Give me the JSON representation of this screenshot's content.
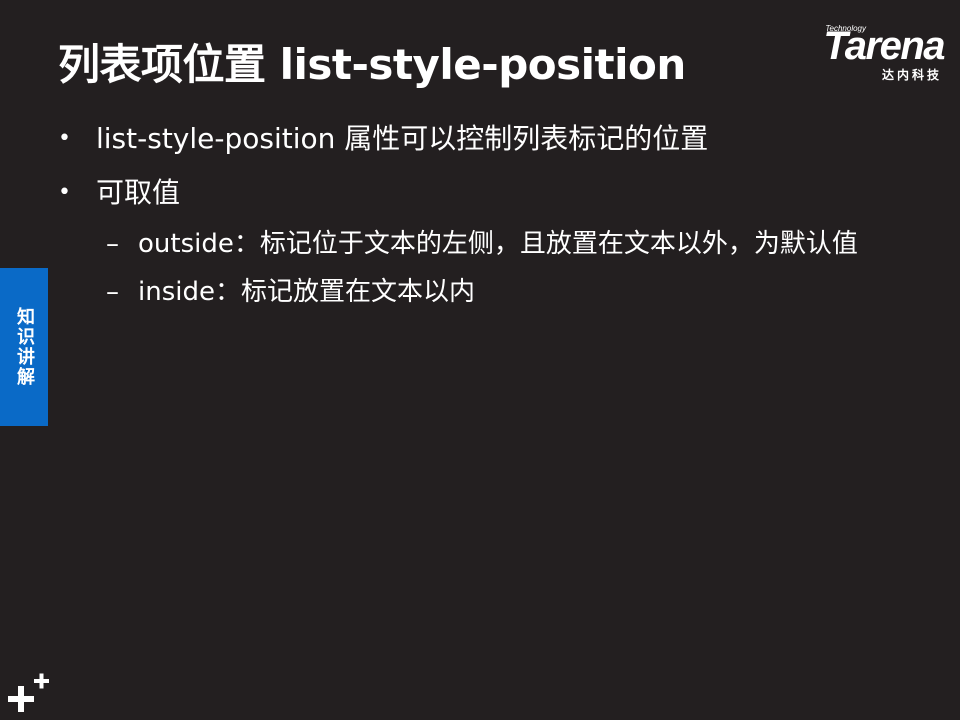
{
  "slide": {
    "title": "列表项位置 list-style-position"
  },
  "logo": {
    "tagline": "Technology",
    "brand": "Tarena",
    "subtitle": "达内科技"
  },
  "side_tab": {
    "label": "知识讲解"
  },
  "content": {
    "bullets": [
      {
        "marker": "•",
        "text": "list-style-position 属性可以控制列表标记的位置"
      },
      {
        "marker": "•",
        "text": "可取值"
      }
    ],
    "sub_bullets": [
      {
        "marker": "–",
        "text": "outside：标记位于文本的左侧，且放置在文本以外，为默认值"
      },
      {
        "marker": "–",
        "text": "inside：标记放置在文本以内"
      }
    ]
  },
  "icons": {
    "corner": "plus-plus-icon"
  },
  "colors": {
    "background": "#231f20",
    "text": "#ffffff",
    "accent": "#0a6ac7"
  }
}
